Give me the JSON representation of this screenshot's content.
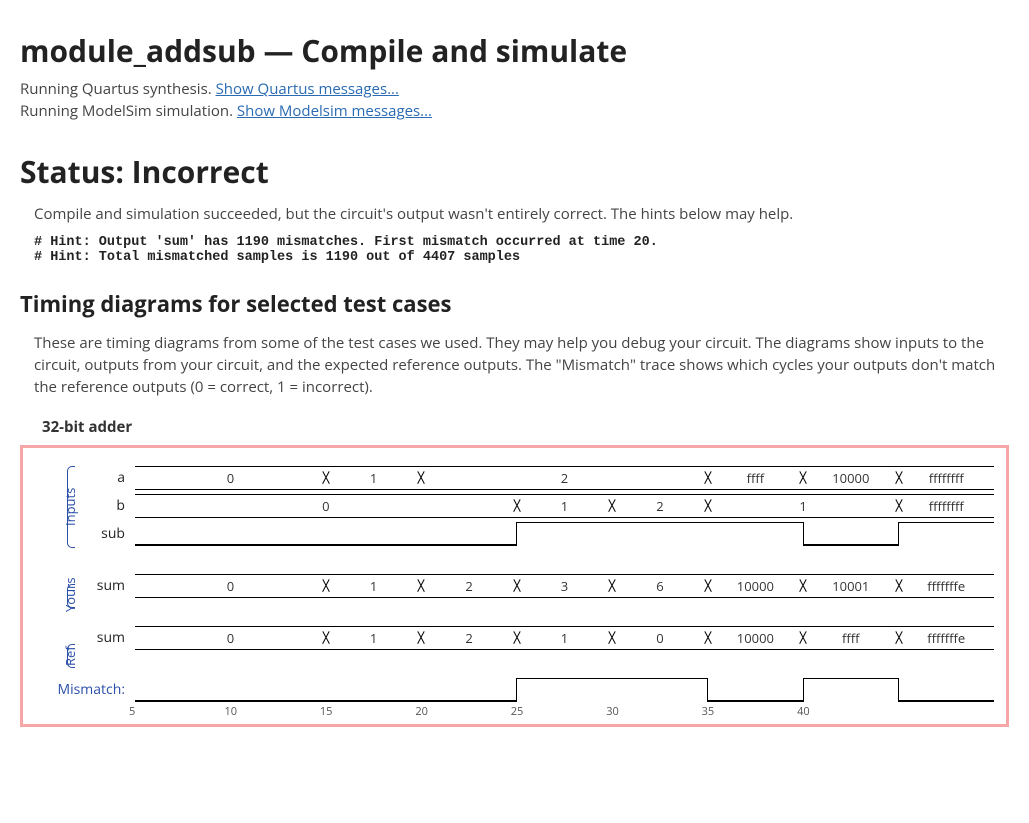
{
  "header": {
    "title": "module_addsub — Compile and simulate",
    "line1_prefix": "Running Quartus synthesis. ",
    "line1_link": "Show Quartus messages...",
    "line2_prefix": "Running ModelSim simulation. ",
    "line2_link": "Show Modelsim messages..."
  },
  "status": {
    "title": "Status: Incorrect",
    "message": "Compile and simulation succeeded, but the circuit's output wasn't entirely correct. The hints below may help.",
    "hints": "# Hint: Output 'sum' has 1190 mismatches. First mismatch occurred at time 20.\n# Hint: Total mismatched samples is 1190 out of 4407 samples"
  },
  "timing": {
    "title": "Timing diagrams for selected test cases",
    "description": "These are timing diagrams from some of the test cases we used. They may help you debug your circuit. The diagrams show inputs to the circuit, outputs from your circuit, and the expected reference outputs. The \"Mismatch\" trace shows which cycles your outputs don't match the reference outputs (0 = correct, 1 = incorrect).",
    "test_name": "32-bit adder",
    "groups": {
      "inputs": "Inputs",
      "yours": "Yours",
      "ref": "Ref",
      "mismatch": "Mismatch:"
    },
    "traces": {
      "a": {
        "label": "a",
        "segments": [
          "0",
          "0",
          "1",
          "2",
          "2",
          "2",
          "ffff",
          "10000",
          "ffffffff"
        ]
      },
      "b": {
        "label": "b",
        "segments": [
          "0",
          "0",
          "0",
          "0",
          "1",
          "2",
          "1",
          "1",
          "ffffffff"
        ]
      },
      "sub": {
        "label": "sub",
        "bits": [
          0,
          0,
          0,
          0,
          1,
          1,
          1,
          0,
          1
        ]
      },
      "yours_sum": {
        "label": "sum",
        "segments": [
          "0",
          "0",
          "1",
          "2",
          "3",
          "6",
          "10000",
          "10001",
          "fffffffe"
        ]
      },
      "ref_sum": {
        "label": "sum",
        "segments": [
          "0",
          "0",
          "1",
          "2",
          "1",
          "0",
          "10000",
          "ffff",
          "fffffffe"
        ]
      },
      "mismatch": {
        "bits": [
          0,
          0,
          0,
          0,
          1,
          1,
          0,
          1,
          0
        ]
      }
    },
    "ticks": [
      "5",
      "10",
      "15",
      "20",
      "25",
      "30",
      "35",
      "40",
      ""
    ]
  }
}
